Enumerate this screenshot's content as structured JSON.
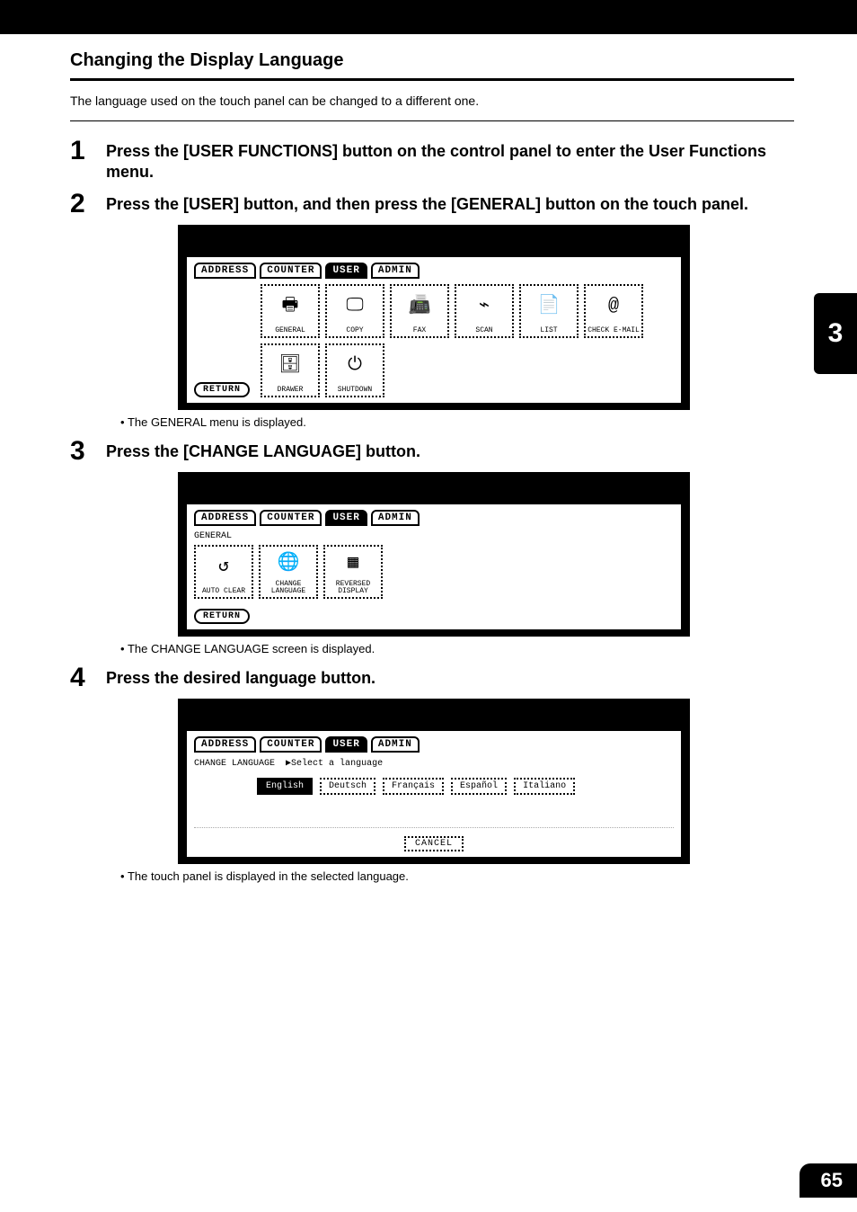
{
  "sectionTitle": "Changing the Display Language",
  "intro": "The language used on the touch panel can be changed to a different one.",
  "steps": {
    "s1": {
      "num": "1",
      "text": "Press the [USER FUNCTIONS] button on the control panel to enter the User Functions menu."
    },
    "s2": {
      "num": "2",
      "text": "Press the [USER] button, and then press the [GENERAL] button on the touch panel."
    },
    "s3": {
      "num": "3",
      "text": "Press the [CHANGE LANGUAGE] button."
    },
    "s4": {
      "num": "4",
      "text": "Press the desired language button."
    }
  },
  "notes": {
    "n1": "The GENERAL menu is displayed.",
    "n2": "The CHANGE LANGUAGE screen is displayed.",
    "n3": "The touch panel is displayed in the selected language."
  },
  "tabs": {
    "address": "ADDRESS",
    "counter": "COUNTER",
    "user": "USER",
    "admin": "ADMIN"
  },
  "screen1": {
    "icons": {
      "general": "GENERAL",
      "copy": "COPY",
      "fax": "FAX",
      "scan": "SCAN",
      "list": "LIST",
      "checkemail": "CHECK E-MAIL",
      "drawer": "DRAWER",
      "shutdown": "SHUTDOWN"
    },
    "return": "RETURN"
  },
  "screen2": {
    "crumb": "GENERAL",
    "icons": {
      "autoclear": "AUTO CLEAR",
      "changelang": "CHANGE\nLANGUAGE",
      "reversed": "REVERSED\nDISPLAY"
    },
    "return": "RETURN"
  },
  "screen3": {
    "crumb": "CHANGE LANGUAGE",
    "prompt": "▶Select a language",
    "langs": {
      "en": "English",
      "de": "Deutsch",
      "fr": "Français",
      "es": "Español",
      "it": "Italiano"
    },
    "cancel": "CANCEL"
  },
  "sideTab": "3",
  "pageNumber": "65"
}
